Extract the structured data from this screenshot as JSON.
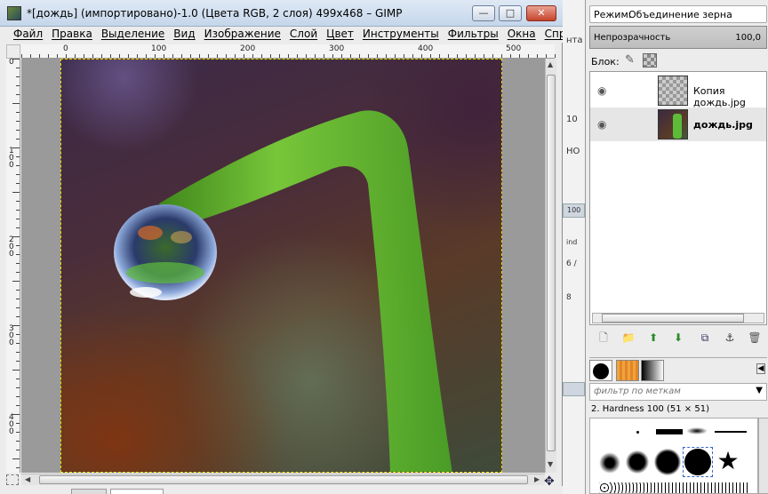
{
  "window": {
    "title": "*[дождь] (импортировано)-1.0 (Цвета RGB, 2 слоя) 499x468 – GIMP",
    "buttons": {
      "minimize": "—",
      "maximize": "□",
      "close": "✕"
    }
  },
  "menu": [
    "Файл",
    "Правка",
    "Выделение",
    "Вид",
    "Изображение",
    "Слой",
    "Цвет",
    "Инструменты",
    "Фильтры",
    "Окна",
    "Справка"
  ],
  "ruler": {
    "top_labels": [
      "0",
      "100",
      "200",
      "300",
      "400",
      "500"
    ],
    "left_labels": [
      "0",
      "100",
      "200",
      "300",
      "400"
    ]
  },
  "behind_window_fragments": [
    "нта",
    "10",
    "НО",
    "100",
    "ind",
    "6 /",
    "8"
  ],
  "layers_dock": {
    "mode_label": "Режим:",
    "mode_value": "Объединение зерна",
    "opacity_label": "Непрозрачность",
    "opacity_value": "100,0",
    "lock_label": "Блок:",
    "layers": [
      {
        "name": "Копия дождь.jpg",
        "visible": true,
        "active": false
      },
      {
        "name": "дождь.jpg",
        "visible": true,
        "active": true
      }
    ],
    "tools": [
      "new-layer-icon",
      "new-layer-group-icon",
      "raise-layer-icon",
      "lower-layer-icon",
      "duplicate-layer-icon",
      "anchor-layer-icon",
      "delete-layer-icon"
    ]
  },
  "brushes_dock": {
    "tag_filter_placeholder": "фильтр по меткам",
    "brush_name": "2. Hardness 100 (51 × 51)"
  }
}
